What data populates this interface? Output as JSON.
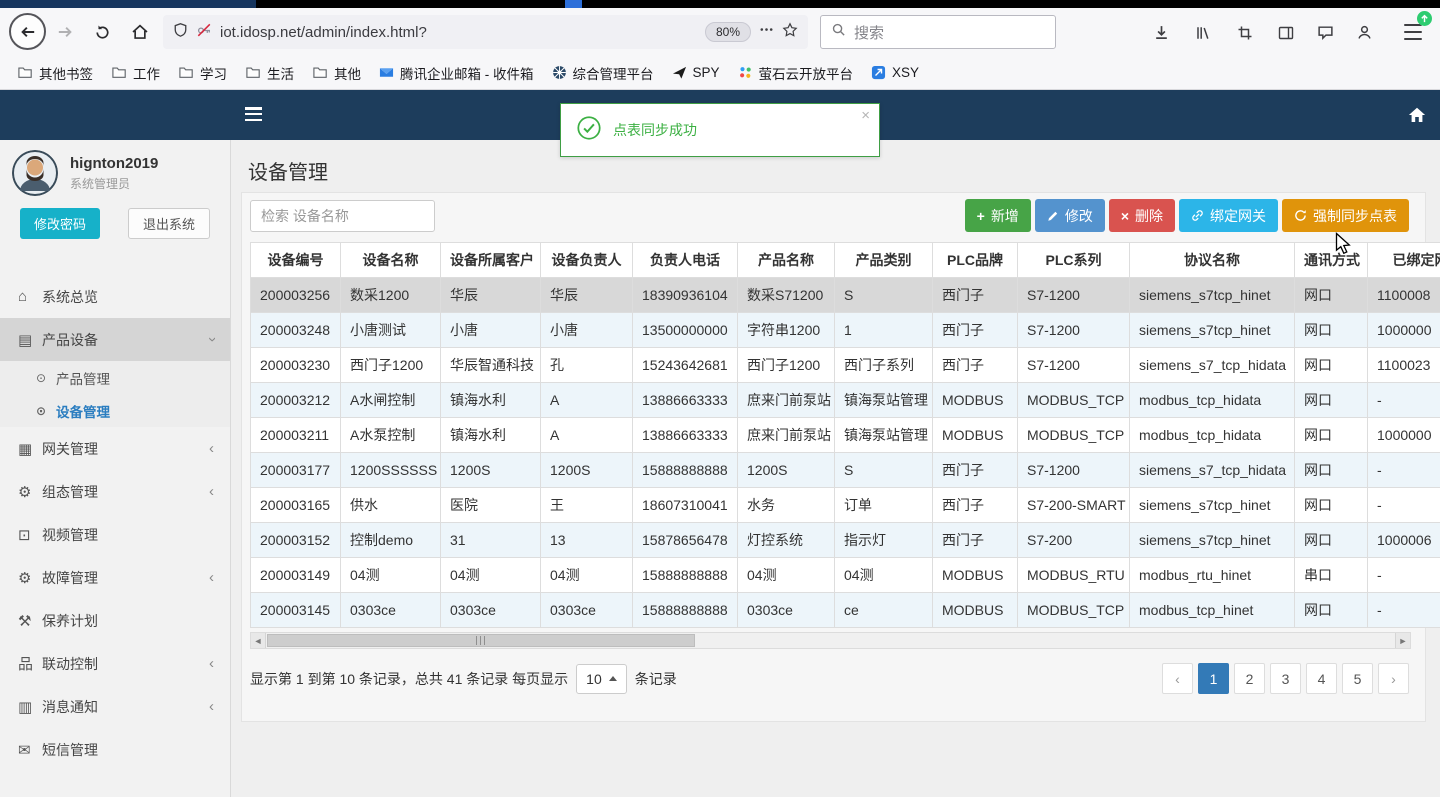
{
  "colors": {
    "app_header": "#1d3d5c",
    "primary_blue": "#337ab7",
    "success_green": "#47a447",
    "edit_blue": "#5493ce",
    "danger_red": "#d9534f",
    "bind_cyan": "#2cb5e8",
    "sync_orange": "#e0940b",
    "toast_green": "#3cb043",
    "password_btn_cyan": "#16b1c9"
  },
  "browser": {
    "url": "iot.idosp.net/admin/index.html?",
    "zoom": "80%",
    "search_placeholder": "搜索",
    "bookmarks": [
      {
        "label": "其他书签",
        "icon": "folder-icon"
      },
      {
        "label": "工作",
        "icon": "folder-icon"
      },
      {
        "label": "学习",
        "icon": "folder-icon"
      },
      {
        "label": "生活",
        "icon": "folder-icon"
      },
      {
        "label": "其他",
        "icon": "folder-icon"
      },
      {
        "label": "腾讯企业邮箱 - 收件箱",
        "icon": "tencent-mail-icon"
      },
      {
        "label": "综合管理平台",
        "icon": "platform-icon"
      },
      {
        "label": "SPY",
        "icon": "spy-icon"
      },
      {
        "label": "萤石云开放平台",
        "icon": "ys-cloud-icon"
      },
      {
        "label": "XSY",
        "icon": "xsy-icon"
      }
    ]
  },
  "app": {
    "toast": {
      "message": "点表同步成功",
      "close": "×"
    },
    "sidebar": {
      "user": {
        "name": "hignton2019",
        "role": "系统管理员"
      },
      "change_password": "修改密码",
      "logout": "退出系统",
      "menu": [
        {
          "label": "系统总览",
          "icon": "overview-icon"
        },
        {
          "label": "产品设备",
          "icon": "product-device-icon",
          "expanded": true,
          "children": [
            {
              "label": "产品管理"
            },
            {
              "label": "设备管理",
              "active": true
            }
          ]
        },
        {
          "label": "网关管理",
          "icon": "gateway-icon",
          "collapsible": true
        },
        {
          "label": "组态管理",
          "icon": "configuration-icon",
          "collapsible": true
        },
        {
          "label": "视频管理",
          "icon": "video-icon"
        },
        {
          "label": "故障管理",
          "icon": "fault-icon",
          "collapsible": true
        },
        {
          "label": "保养计划",
          "icon": "maintenance-icon"
        },
        {
          "label": "联动控制",
          "icon": "linkage-icon",
          "collapsible": true
        },
        {
          "label": "消息通知",
          "icon": "notification-icon",
          "collapsible": true
        },
        {
          "label": "短信管理",
          "icon": "sms-icon"
        }
      ]
    },
    "main": {
      "title": "设备管理",
      "search_placeholder": "检索 设备名称",
      "buttons": [
        {
          "name": "add-button",
          "label": "新增",
          "icon": "plus-icon",
          "color": "#47a447"
        },
        {
          "name": "edit-button",
          "label": "修改",
          "icon": "pencil-icon",
          "color": "#5493ce"
        },
        {
          "name": "delete-button",
          "label": "删除",
          "icon": "delete-icon",
          "color": "#d9534f"
        },
        {
          "name": "bind-gateway-button",
          "label": "绑定网关",
          "icon": "link-icon",
          "color": "#2cb5e8"
        },
        {
          "name": "force-sync-button",
          "label": "强制同步点表",
          "icon": "sync-icon",
          "color": "#e0940b"
        }
      ],
      "table": {
        "columns": [
          "设备编号",
          "设备名称",
          "设备所属客户",
          "设备负责人",
          "负责人电话",
          "产品名称",
          "产品类别",
          "PLC品牌",
          "PLC系列",
          "协议名称",
          "通讯方式",
          "已绑定网关"
        ],
        "selected_row": 0,
        "rows": [
          [
            "200003256",
            "数采1200",
            "华辰",
            "华辰",
            "18390936104",
            "数采S71200",
            "S",
            "西门子",
            "S7-1200",
            "siemens_s7tcp_hinet",
            "网口",
            "1100008"
          ],
          [
            "200003248",
            "小唐测试",
            "小唐",
            "小唐",
            "13500000000",
            "字符串1200",
            "1",
            "西门子",
            "S7-1200",
            "siemens_s7tcp_hinet",
            "网口",
            "1000000"
          ],
          [
            "200003230",
            "西门子1200",
            "华辰智通科技",
            "孔",
            "15243642681",
            "西门子1200",
            "西门子系列",
            "西门子",
            "S7-1200",
            "siemens_s7_tcp_hidata",
            "网口",
            "1100023"
          ],
          [
            "200003212",
            "A水闸控制",
            "镇海水利",
            "A",
            "13886663333",
            "庶来门前泵站",
            "镇海泵站管理",
            "MODBUS",
            "MODBUS_TCP",
            "modbus_tcp_hidata",
            "网口",
            "-"
          ],
          [
            "200003211",
            "A水泵控制",
            "镇海水利",
            "A",
            "13886663333",
            "庶来门前泵站",
            "镇海泵站管理",
            "MODBUS",
            "MODBUS_TCP",
            "modbus_tcp_hidata",
            "网口",
            "1000000"
          ],
          [
            "200003177",
            "1200SSSSSS",
            "1200S",
            "1200S",
            "15888888888",
            "1200S",
            "S",
            "西门子",
            "S7-1200",
            "siemens_s7_tcp_hidata",
            "网口",
            "-"
          ],
          [
            "200003165",
            "供水",
            "医院",
            "王",
            "18607310041",
            "水务",
            "订单",
            "西门子",
            "S7-200-SMART",
            "siemens_s7tcp_hinet",
            "网口",
            "-"
          ],
          [
            "200003152",
            "控制demo",
            "31",
            "13",
            "15878656478",
            "灯控系统",
            "指示灯",
            "西门子",
            "S7-200",
            "siemens_s7tcp_hinet",
            "网口",
            "1000006"
          ],
          [
            "200003149",
            "04测",
            "04测",
            "04测",
            "15888888888",
            "04测",
            "04测",
            "MODBUS",
            "MODBUS_RTU",
            "modbus_rtu_hinet",
            "串口",
            "-"
          ],
          [
            "200003145",
            "0303ce",
            "0303ce",
            "0303ce",
            "15888888888",
            "0303ce",
            "ce",
            "MODBUS",
            "MODBUS_TCP",
            "modbus_tcp_hinet",
            "网口",
            "-"
          ]
        ]
      },
      "pagination": {
        "summary_prefix": "显示第 1 到第 10 条记录，总共 41 条记录 每页显示",
        "page_size": "10",
        "summary_suffix": "条记录",
        "pages": [
          "‹",
          "1",
          "2",
          "3",
          "4",
          "5",
          "›"
        ],
        "active_page": "1"
      }
    }
  }
}
